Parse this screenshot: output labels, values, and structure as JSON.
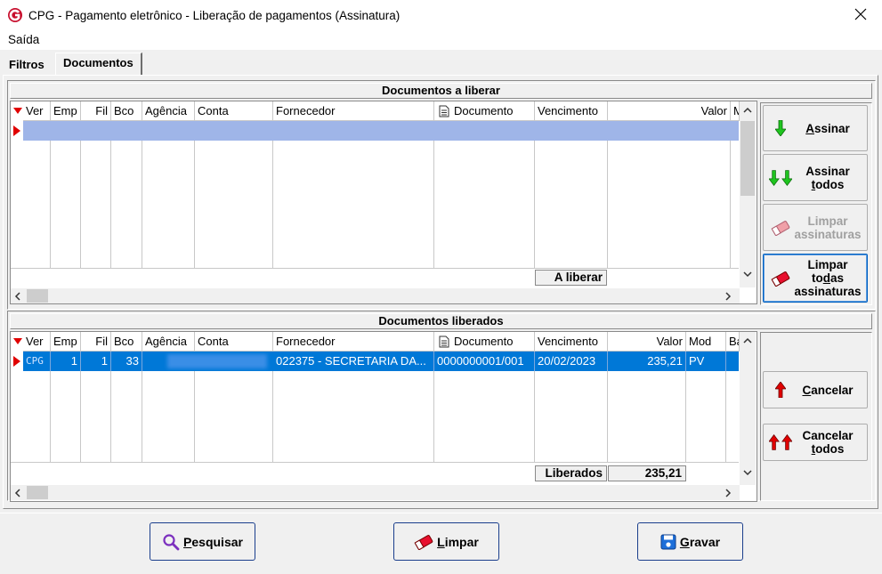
{
  "window": {
    "title": "CPG - Pagamento eletrônico - Liberação de pagamentos (Assinatura)"
  },
  "menu": {
    "items": [
      {
        "label": "Saída"
      }
    ]
  },
  "tabs": [
    {
      "label": "Filtros"
    },
    {
      "label": "Documentos"
    }
  ],
  "top_section": {
    "title": "Documentos a liberar",
    "columns": [
      "Ver",
      "Emp",
      "Fil",
      "Bco",
      "Agência",
      "Conta",
      "Fornecedor",
      "Documento",
      "Vencimento",
      "Valor",
      "M"
    ],
    "footer_label": "A liberar",
    "footer_value": ""
  },
  "bottom_section": {
    "title": "Documentos liberados",
    "columns": [
      "Ver",
      "Emp",
      "Fil",
      "Bco",
      "Agência",
      "Conta",
      "Fornecedor",
      "Documento",
      "Vencimento",
      "Valor",
      "Mod",
      "Ba"
    ],
    "rows": [
      {
        "ver": "CPG",
        "emp": "1",
        "fil": "1",
        "bco": "33",
        "fornecedor": "022375 - SECRETARIA DA...",
        "documento": "0000000001/001",
        "vencimento": "20/02/2023",
        "valor": "235,21",
        "mod": "PV"
      }
    ],
    "footer_label": "Liberados",
    "footer_value": "235,21"
  },
  "side_buttons_top": {
    "assinar": {
      "pre": "",
      "u": "A",
      "post": "ssinar"
    },
    "assinar_todos": {
      "line1": "Assinar",
      "line2_pre": "",
      "line2_u": "t",
      "line2_post": "odos"
    },
    "limpar_assinaturas": {
      "line1": "Limpar",
      "line2": "assinaturas"
    },
    "limpar_todas": {
      "line1": "Limpar",
      "line2_pre": "to",
      "line2_u": "d",
      "line2_post": "as",
      "line3": "assinaturas"
    }
  },
  "side_buttons_bottom": {
    "cancelar": {
      "pre": "",
      "u": "C",
      "post": "ancelar"
    },
    "cancelar_todos": {
      "line1": "Cancelar",
      "line2_pre": "",
      "line2_u": "t",
      "line2_post": "odos"
    }
  },
  "bottom_buttons": {
    "pesquisar": {
      "u": "P",
      "post": "esquisar"
    },
    "limpar": {
      "u": "L",
      "post": "impar"
    },
    "gravar": {
      "u": "G",
      "post": "ravar"
    }
  },
  "icons": {
    "app": "cpg-logo-icon",
    "close": "close-icon",
    "search": "magnifier-icon",
    "eraser": "eraser-icon",
    "save": "floppy-disk-icon",
    "document": "document-icon",
    "arrow_down_green": "arrow-down-icon",
    "arrow_up_red": "arrow-up-icon"
  },
  "colors": {
    "selection": "#0078d7",
    "empty_row": "#9fb5e8",
    "indicator": "#e00000",
    "green_arrow": "#1fc41f",
    "red_arrow": "#e00000"
  }
}
